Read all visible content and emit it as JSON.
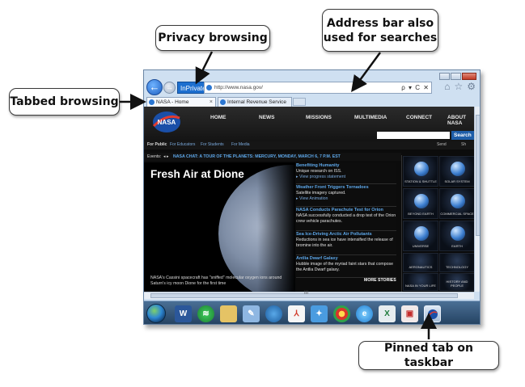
{
  "callouts": {
    "privacy": "Privacy browsing",
    "address_line1": "Address bar also",
    "address_line2": "used for searches",
    "tabbed": "Tabbed browsing",
    "pinned": "Pinned tab on taskbar"
  },
  "browser": {
    "inprivate_label": "InPrivate",
    "address_url": "http://www.nasa.gov/",
    "address_tools": "ρ ▾ C ✕",
    "tabs": [
      {
        "label": "NASA - Home",
        "close": "×"
      },
      {
        "label": "Internal Revenue Service",
        "close": ""
      }
    ],
    "toolbar_icons": [
      "home-icon",
      "favorites-icon",
      "tools-icon"
    ]
  },
  "nasa_page": {
    "logo": "NASA",
    "nav": [
      "HOME",
      "NEWS",
      "MISSIONS",
      "MULTIMEDIA",
      "CONNECT",
      "ABOUT NASA"
    ],
    "search_button": "Search",
    "audience": {
      "main": "For Public",
      "links": [
        "For Educators",
        "For Students",
        "For Media"
      ],
      "tools": [
        "Send",
        "Sh"
      ]
    },
    "events": {
      "label": "Events:",
      "arrows": "◂ ▸",
      "text": "NASA CHAT: A TOUR OF THE PLANETS: MERCURY, MONDAY, MARCH 6, 7 P.M. EST"
    },
    "feature": {
      "title": "Fresh Air at Dione",
      "caption": "NASA's Cassini spacecraft has \"sniffed\" molecular oxygen ions around Saturn's icy moon Dione for the first time"
    },
    "stories": [
      {
        "title": "Benefiting Humanity",
        "body": "Unique research on ISS.",
        "link": "▸ View progress statement"
      },
      {
        "title": "Weather Front Triggers Tornadoes",
        "body": "Satellite imagery captured.",
        "link": "▸ View Animation"
      },
      {
        "title": "NASA Conducts Parachute Test for Orion",
        "body": "NASA successfully conducted a drop test of the Orion crew vehicle parachutes.",
        "link": ""
      },
      {
        "title": "Sea Ice-Driving Arctic Air Pollutants",
        "body": "Reductions in sea ice have intensified the release of bromine into the air.",
        "link": ""
      },
      {
        "title": "Antlia Dwarf Galaxy",
        "body": "Hubble image of the myriad faint stars that compose the Antlia Dwarf galaxy.",
        "link": ""
      }
    ],
    "more_stories": "MORE STORIES",
    "topics": [
      "STATION & SHUTTLE",
      "SOLAR SYSTEM",
      "BEYOND EARTH",
      "COMMERCIAL SPACE",
      "UNIVERSE",
      "EARTH",
      "AERONAUTICS",
      "TECHNOLOGY",
      "NASA IN YOUR LIFE",
      "HISTORY AND PEOPLE"
    ]
  },
  "scrollbar_mark": "III",
  "taskbar": {
    "start": "start-orb-icon",
    "items": [
      "word-icon",
      "spotify-icon",
      "explorer-icon",
      "paint-icon",
      "globe-icon",
      "acrobat-icon",
      "bird-icon",
      "chrome-icon",
      "ie-icon",
      "excel-icon",
      "pdf-icon",
      "nasa-pinned-tab-icon"
    ]
  }
}
